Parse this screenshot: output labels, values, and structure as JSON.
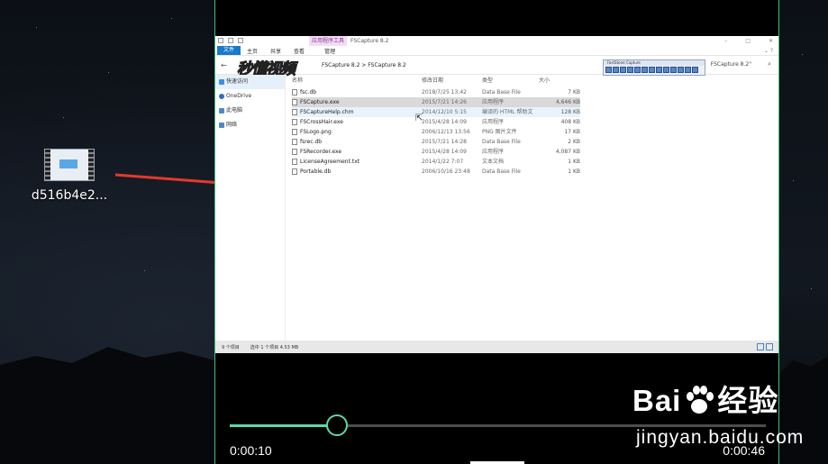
{
  "desktop": {
    "file_label": "d516b4e2..."
  },
  "explorer": {
    "tool_tab": "应用程序工具",
    "window_title": "FSCapture 8.2",
    "menu": [
      "文件",
      "主页",
      "共享",
      "查看",
      "管理"
    ],
    "breadcrumb": "FSCapture 8.2 > FSCapture 8.2",
    "search_text": "FSCapture 8.2\"",
    "nav": [
      "快速访问",
      "OneDrive",
      "此电脑",
      "网络"
    ],
    "columns": [
      "名称",
      "修改日期",
      "类型",
      "大小"
    ],
    "files": [
      {
        "name": "fsc.db",
        "date": "2018/7/25 13:42",
        "type": "Data Base File",
        "size": "7 KB"
      },
      {
        "name": "FSCapture.exe",
        "date": "2015/7/21 14:26",
        "type": "应用程序",
        "size": "4,646 KB"
      },
      {
        "name": "FSCaptureHelp.chm",
        "date": "2014/12/10 5:15",
        "type": "编译的 HTML 帮助文",
        "size": "128 KB"
      },
      {
        "name": "FSCrossHair.exe",
        "date": "2015/4/28 14:09",
        "type": "应用程序",
        "size": "408 KB"
      },
      {
        "name": "FSLogo.png",
        "date": "2006/12/13 13:56",
        "type": "PNG 图片文件",
        "size": "17 KB"
      },
      {
        "name": "fsrec.db",
        "date": "2015/7/21 14:28",
        "type": "Data Base File",
        "size": "2 KB"
      },
      {
        "name": "FSRecorder.exe",
        "date": "2015/4/28 14:09",
        "type": "应用程序",
        "size": "4,087 KB"
      },
      {
        "name": "LicenseAgreement.txt",
        "date": "2014/1/22 7:07",
        "type": "文本文档",
        "size": "1 KB"
      },
      {
        "name": "Portable.db",
        "date": "2006/10/16 23:48",
        "type": "Data Base File",
        "size": "1 KB"
      }
    ],
    "status_count": "9 个项目",
    "status_selected": "选中 1 个项目  4.53 MB",
    "fastone_title": "FastStone Capture",
    "watermark": "秒懂视频"
  },
  "player": {
    "current_time": "0:00:10",
    "total_time": "0:00:46",
    "progress": 0.2,
    "accent": "#5fd8a8"
  },
  "baidu": {
    "brand_left": "Bai",
    "brand_right": "经验",
    "site": "jingyan.baidu.com"
  }
}
